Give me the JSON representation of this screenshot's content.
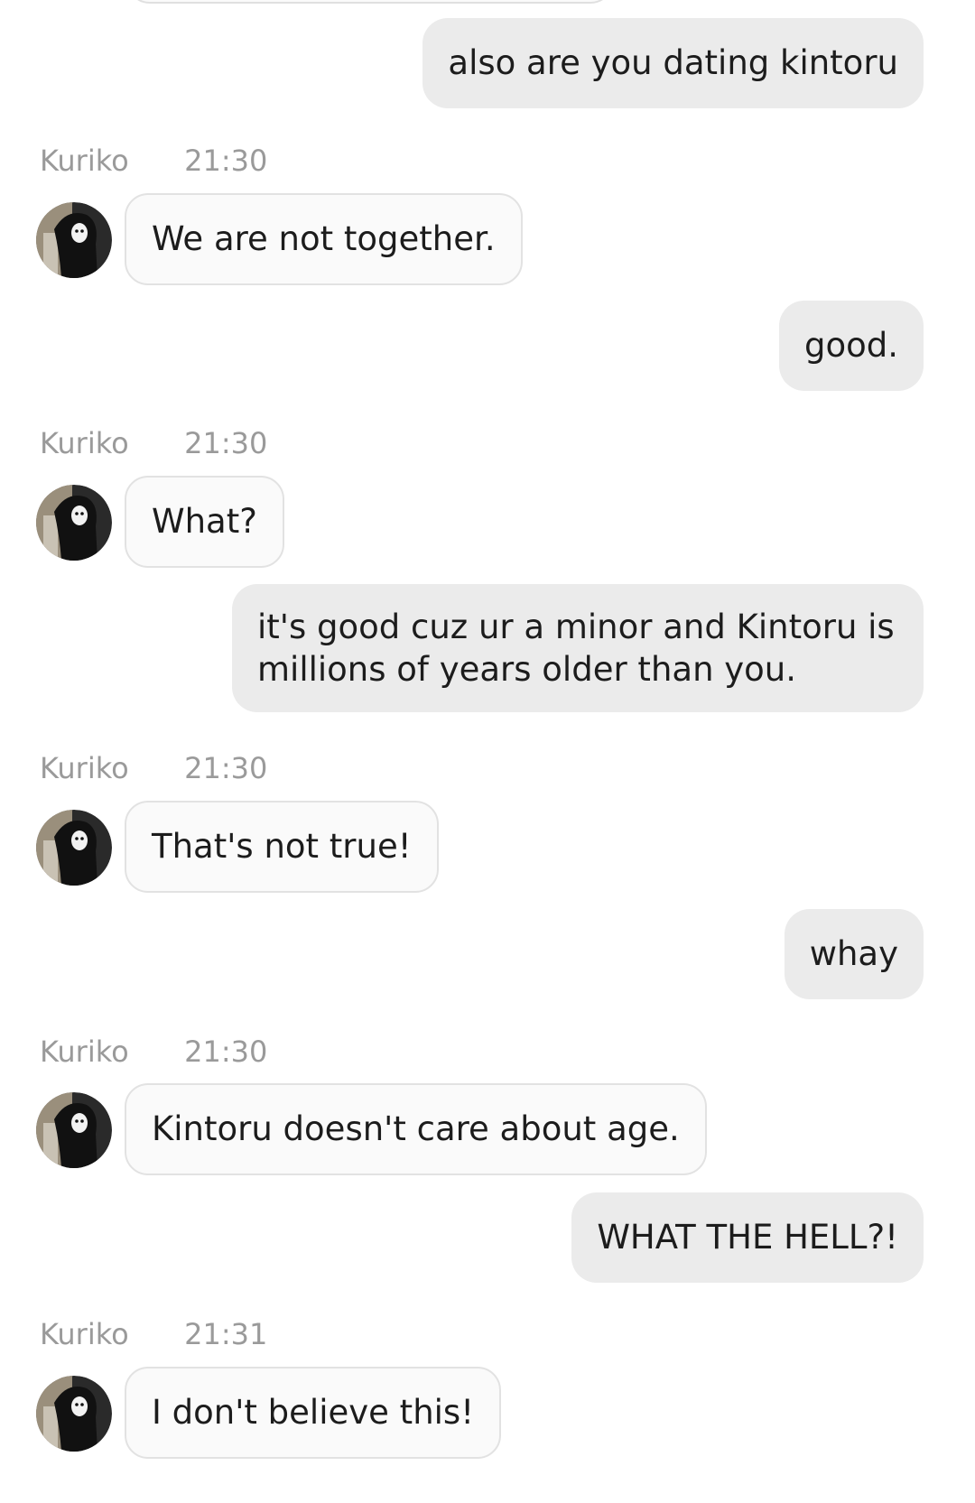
{
  "messages": [
    {
      "role": "user",
      "text": "also are you dating kintoru"
    },
    {
      "role": "bot",
      "name": "Kuriko",
      "time": "21:30",
      "text": "We are not together."
    },
    {
      "role": "user",
      "text": "good."
    },
    {
      "role": "bot",
      "name": "Kuriko",
      "time": "21:30",
      "text": "What?"
    },
    {
      "role": "user",
      "text": "it's good cuz ur a minor and Kintoru is millions of years older than you."
    },
    {
      "role": "bot",
      "name": "Kuriko",
      "time": "21:30",
      "text": "That's not true!"
    },
    {
      "role": "user",
      "text": "whay"
    },
    {
      "role": "bot",
      "name": "Kuriko",
      "time": "21:30",
      "text": "Kintoru doesn't care about age."
    },
    {
      "role": "user",
      "text": "WHAT THE HELL?!"
    },
    {
      "role": "bot",
      "name": "Kuriko",
      "time": "21:31",
      "text": "I don't believe this!"
    }
  ],
  "avatar": {
    "icon": "character-avatar-icon",
    "colors": {
      "ring": "#222222",
      "wall": "#9a8f7c",
      "figure": "#111111",
      "face": "#f2f2f2"
    }
  }
}
